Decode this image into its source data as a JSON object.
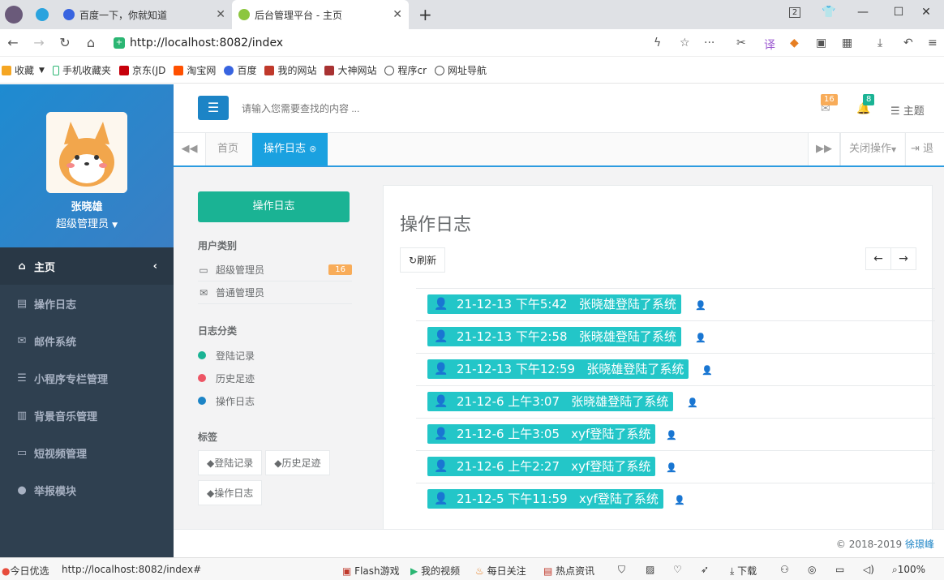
{
  "browser": {
    "tabs": [
      {
        "title": "百度一下，你就知道",
        "active": false
      },
      {
        "title": "后台管理平台 - 主页",
        "active": true
      }
    ],
    "new_tab": "+",
    "window_badge": "2",
    "url": "http://localhost:8082/index",
    "bookmarks": [
      "收藏",
      "手机收藏夹",
      "京东(JD",
      "淘宝网",
      "百度",
      "我的网站",
      "大神网站",
      "程序cr",
      "网址导航"
    ]
  },
  "sidebar": {
    "user_name": "张晓雄",
    "user_role": "超级管理员",
    "menu": [
      {
        "label": "主页",
        "icon": "home-icon"
      },
      {
        "label": "操作日志",
        "icon": "calendar-icon"
      },
      {
        "label": "邮件系统",
        "icon": "envelope-icon"
      },
      {
        "label": "小程序专栏管理",
        "icon": "list-icon"
      },
      {
        "label": "背景音乐管理",
        "icon": "bar-chart-icon"
      },
      {
        "label": "短视频管理",
        "icon": "monitor-icon"
      },
      {
        "label": "举报模块",
        "icon": "info-icon"
      }
    ]
  },
  "header": {
    "search_placeholder": "请输入您需要查找的内容 ...",
    "mail_count": "16",
    "bell_count": "8",
    "theme_label": "主题"
  },
  "tabstrip": {
    "home": "首页",
    "current": "操作日志",
    "close_ops": "关闭操作",
    "logout": "退出"
  },
  "left": {
    "primary_button": "操作日志",
    "user_type_heading": "用户类别",
    "user_types": [
      {
        "label": "超级管理员",
        "count": "16"
      },
      {
        "label": "普通管理员"
      }
    ],
    "log_cat_heading": "日志分类",
    "log_cats": [
      {
        "label": "登陆记录",
        "color": "#1ab394"
      },
      {
        "label": "历史足迹",
        "color": "#ed5565"
      },
      {
        "label": "操作日志",
        "color": "#1c84c6"
      }
    ],
    "tags_heading": "标签",
    "tags": [
      "登陆记录",
      "历史足迹",
      "操作日志"
    ]
  },
  "panel": {
    "title": "操作日志",
    "refresh": "刷新",
    "logs": [
      "21-12-13 下午5:42   张晓雄登陆了系统",
      "21-12-13 下午2:58   张晓雄登陆了系统",
      "21-12-13 下午12:59   张晓雄登陆了系统",
      "21-12-6 上午3:07   张晓雄登陆了系统",
      "21-12-6 上午3:05   xyf登陆了系统",
      "21-12-6 上午2:27   xyf登陆了系统",
      "21-12-5 下午11:59   xyf登陆了系统"
    ]
  },
  "footer": {
    "copyright": "© 2018-2019",
    "author": "徐璟峰"
  },
  "statusbar": {
    "today": "今日优选",
    "hover_url": "http://localhost:8082/index#",
    "items": [
      "Flash游戏",
      "我的视频",
      "每日关注",
      "热点资讯"
    ],
    "download": "下载",
    "zoom": "100%"
  }
}
